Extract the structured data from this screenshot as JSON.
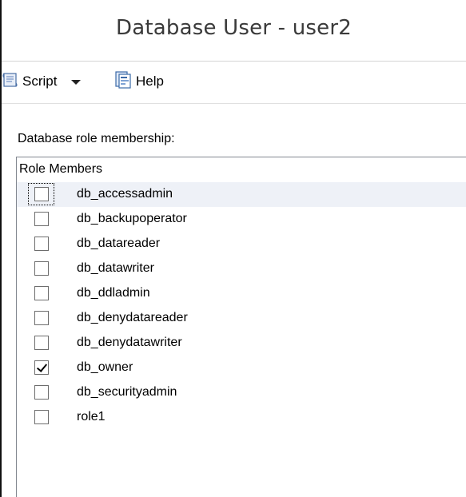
{
  "window": {
    "title": "Database User - user2"
  },
  "toolbar": {
    "script_label": "Script",
    "help_label": "Help"
  },
  "roles": {
    "section_label": "Database role membership:",
    "column_header": "Role Members",
    "items": [
      {
        "label": "db_accessadmin",
        "checked": false,
        "selected": true
      },
      {
        "label": "db_backupoperator",
        "checked": false,
        "selected": false
      },
      {
        "label": "db_datareader",
        "checked": false,
        "selected": false
      },
      {
        "label": "db_datawriter",
        "checked": false,
        "selected": false
      },
      {
        "label": "db_ddladmin",
        "checked": false,
        "selected": false
      },
      {
        "label": "db_denydatareader",
        "checked": false,
        "selected": false
      },
      {
        "label": "db_denydatawriter",
        "checked": false,
        "selected": false
      },
      {
        "label": "db_owner",
        "checked": true,
        "selected": false
      },
      {
        "label": "db_securityadmin",
        "checked": false,
        "selected": false
      },
      {
        "label": "role1",
        "checked": false,
        "selected": false
      }
    ]
  }
}
